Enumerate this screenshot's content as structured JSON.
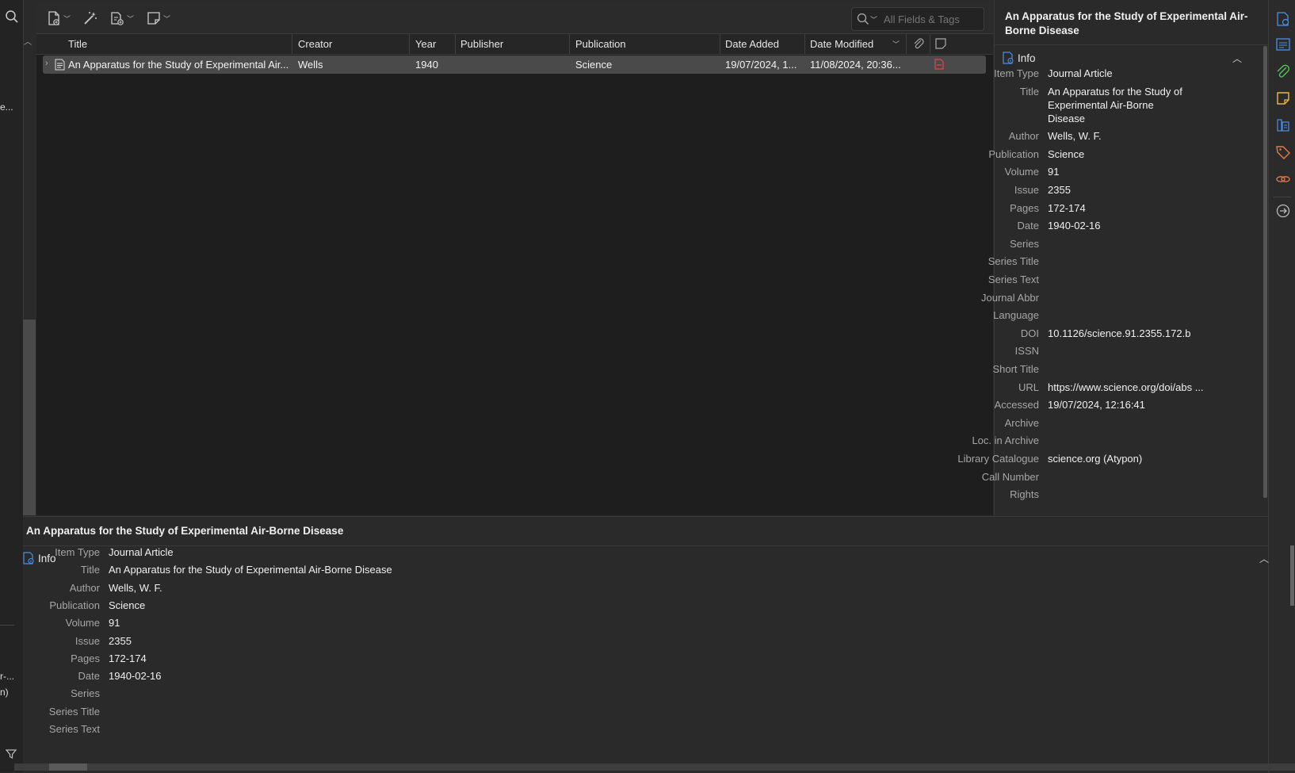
{
  "left_pane": {
    "fragments": [
      "e...",
      "r-...",
      "n)"
    ]
  },
  "toolbar": {
    "new_item_icon": "new-item-icon",
    "magic_wand_icon": "add-by-identifier-icon",
    "attachment_icon": "new-attachment-icon",
    "note_icon": "new-note-icon",
    "search_placeholder": "All Fields & Tags"
  },
  "table": {
    "columns": [
      "Title",
      "Creator",
      "Year",
      "Publisher",
      "Publication",
      "Date Added",
      "Date Modified"
    ],
    "rows": [
      {
        "title": "An Apparatus for the Study of Experimental Air...",
        "creator": "Wells",
        "year": "1940",
        "publisher": "",
        "publication": "Science",
        "date_added": "19/07/2024, 1...",
        "date_modified": "11/08/2024, 20:36..."
      }
    ]
  },
  "right_pane": {
    "header": "An Apparatus for the Study of Experimental Air-Borne Disease",
    "section": "Info",
    "fields": [
      {
        "label": "Item Type",
        "value": "Journal Article"
      },
      {
        "label": "Title",
        "value_lines": [
          "An Apparatus for the Study of",
          "Experimental Air-Borne",
          "Disease"
        ]
      },
      {
        "label": "Author",
        "value": "Wells, W. F."
      },
      {
        "label": "Publication",
        "value": "Science"
      },
      {
        "label": "Volume",
        "value": "91"
      },
      {
        "label": "Issue",
        "value": "2355"
      },
      {
        "label": "Pages",
        "value": "172-174"
      },
      {
        "label": "Date",
        "value": "1940-02-16"
      },
      {
        "label": "Series",
        "value": ""
      },
      {
        "label": "Series Title",
        "value": ""
      },
      {
        "label": "Series Text",
        "value": ""
      },
      {
        "label": "Journal Abbr",
        "value": ""
      },
      {
        "label": "Language",
        "value": ""
      },
      {
        "label": "DOI",
        "value": "10.1126/science.91.2355.172.b"
      },
      {
        "label": "ISSN",
        "value": ""
      },
      {
        "label": "Short Title",
        "value": ""
      },
      {
        "label": "URL",
        "value": "https://www.science.org/doi/abs ..."
      },
      {
        "label": "Accessed",
        "value": "19/07/2024, 12:16:41"
      },
      {
        "label": "Archive",
        "value": ""
      },
      {
        "label": "Loc. in Archive",
        "value": ""
      },
      {
        "label": "Library Catalogue",
        "value": "science.org (Atypon)"
      },
      {
        "label": "Call Number",
        "value": ""
      },
      {
        "label": "Rights",
        "value": ""
      }
    ]
  },
  "bottom_pane": {
    "title": "An Apparatus for the Study of Experimental Air-Borne Disease",
    "section": "Info",
    "fields": [
      {
        "label": "Item Type",
        "value": "Journal Article"
      },
      {
        "label": "Title",
        "value": "An Apparatus for the Study of Experimental Air-Borne Disease"
      },
      {
        "label": "Author",
        "value": "Wells, W. F."
      },
      {
        "label": "Publication",
        "value": "Science"
      },
      {
        "label": "Volume",
        "value": "91"
      },
      {
        "label": "Issue",
        "value": "2355"
      },
      {
        "label": "Pages",
        "value": "172-174"
      },
      {
        "label": "Date",
        "value": "1940-02-16"
      },
      {
        "label": "Series",
        "value": ""
      },
      {
        "label": "Series Title",
        "value": ""
      },
      {
        "label": "Series Text",
        "value": ""
      }
    ]
  },
  "colors": {
    "background": "#2a2a2a",
    "accent_blue": "#4a8fe7",
    "attachment_green": "#5bbf5b",
    "note_yellow": "#e8b64a",
    "tag_orange": "#e87a4a",
    "pdf_red": "#e04848"
  }
}
